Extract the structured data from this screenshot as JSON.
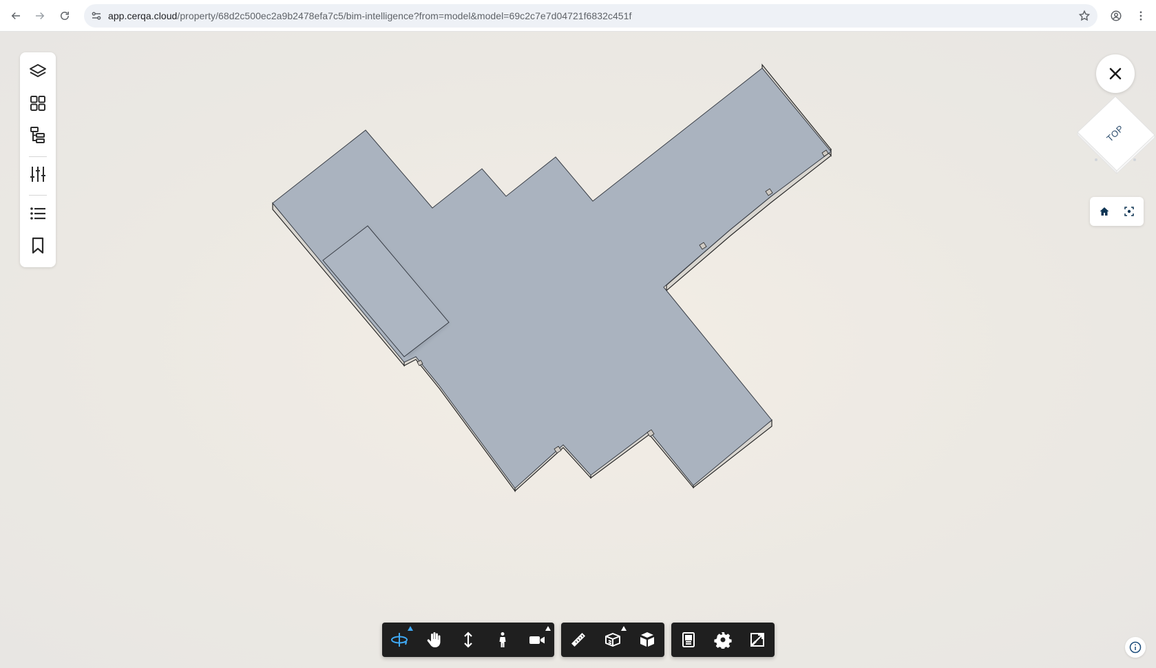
{
  "browser": {
    "url_host": "app.cerqa.cloud",
    "url_path": "/property/68d2c500ec2a9b2478efa7c5/bim-intelligence?from=model&model=69c2c7e7d04721f6832c451f"
  },
  "view_cube": {
    "face_label": "TOP"
  },
  "left_panel": {
    "tools": [
      {
        "name": "layers",
        "icon": "layers-icon"
      },
      {
        "name": "grid",
        "icon": "grid-icon"
      },
      {
        "name": "model-tree",
        "icon": "hierarchy-icon"
      },
      {
        "name": "properties",
        "icon": "sliders-icon"
      },
      {
        "name": "list",
        "icon": "list-icon"
      },
      {
        "name": "bookmarks",
        "icon": "bookmark-icon"
      }
    ]
  },
  "toolbar": {
    "navigation": [
      "orbit-icon",
      "pan-icon",
      "zoom-icon",
      "walk-icon",
      "camera-icon"
    ],
    "modeling": [
      "measure-icon",
      "section-box-icon",
      "explode-icon"
    ],
    "settings": [
      "properties-panel-icon",
      "settings-gear-icon",
      "fullscreen-icon"
    ],
    "active_tool": "orbit-icon"
  },
  "colors": {
    "model_top": "#aab3bf",
    "model_edge": "#2a2a2a",
    "toolbar_bg": "#1f1f1f",
    "active_accent": "#3fa9f5",
    "background": "#ece9e3"
  }
}
